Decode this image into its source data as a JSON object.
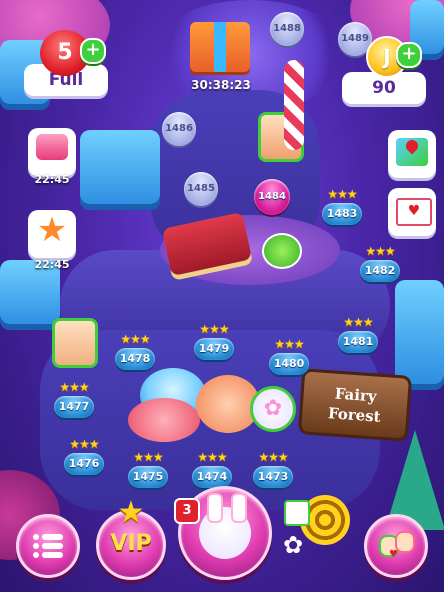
{
  "hud": {
    "lives_count": "5",
    "lives_status": "Full",
    "coins": "90",
    "coin_symbol": "J",
    "gift_timer": "30:38:23"
  },
  "events": [
    {
      "timer": "22:45",
      "icon": "cake-icon"
    },
    {
      "timer": "22:45",
      "icon": "starfish-icon"
    }
  ],
  "side_buttons": [
    {
      "icon": "map-icon"
    },
    {
      "icon": "mail-icon"
    }
  ],
  "levels": {
    "l1473": "1473",
    "l1474": "1474",
    "l1475": "1475",
    "l1476": "1476",
    "l1477": "1477",
    "l1478": "1478",
    "l1479": "1479",
    "l1480": "1480",
    "l1481": "1481",
    "l1482": "1482",
    "l1483": "1483",
    "l1484": "1484",
    "l1485": "1485",
    "l1486": "1486",
    "l1488": "1488",
    "l1489": "1489"
  },
  "stars_glyph": "★★★",
  "sign": {
    "line1": "Fairy",
    "line2": "Forest"
  },
  "bottom": {
    "vip_label": "VIP",
    "bunny_badge": "3"
  },
  "colors": {
    "accent": "#e03cb0",
    "path": "#3a2f9a",
    "level": "#2a8fd8",
    "star": "#ffd21e"
  }
}
